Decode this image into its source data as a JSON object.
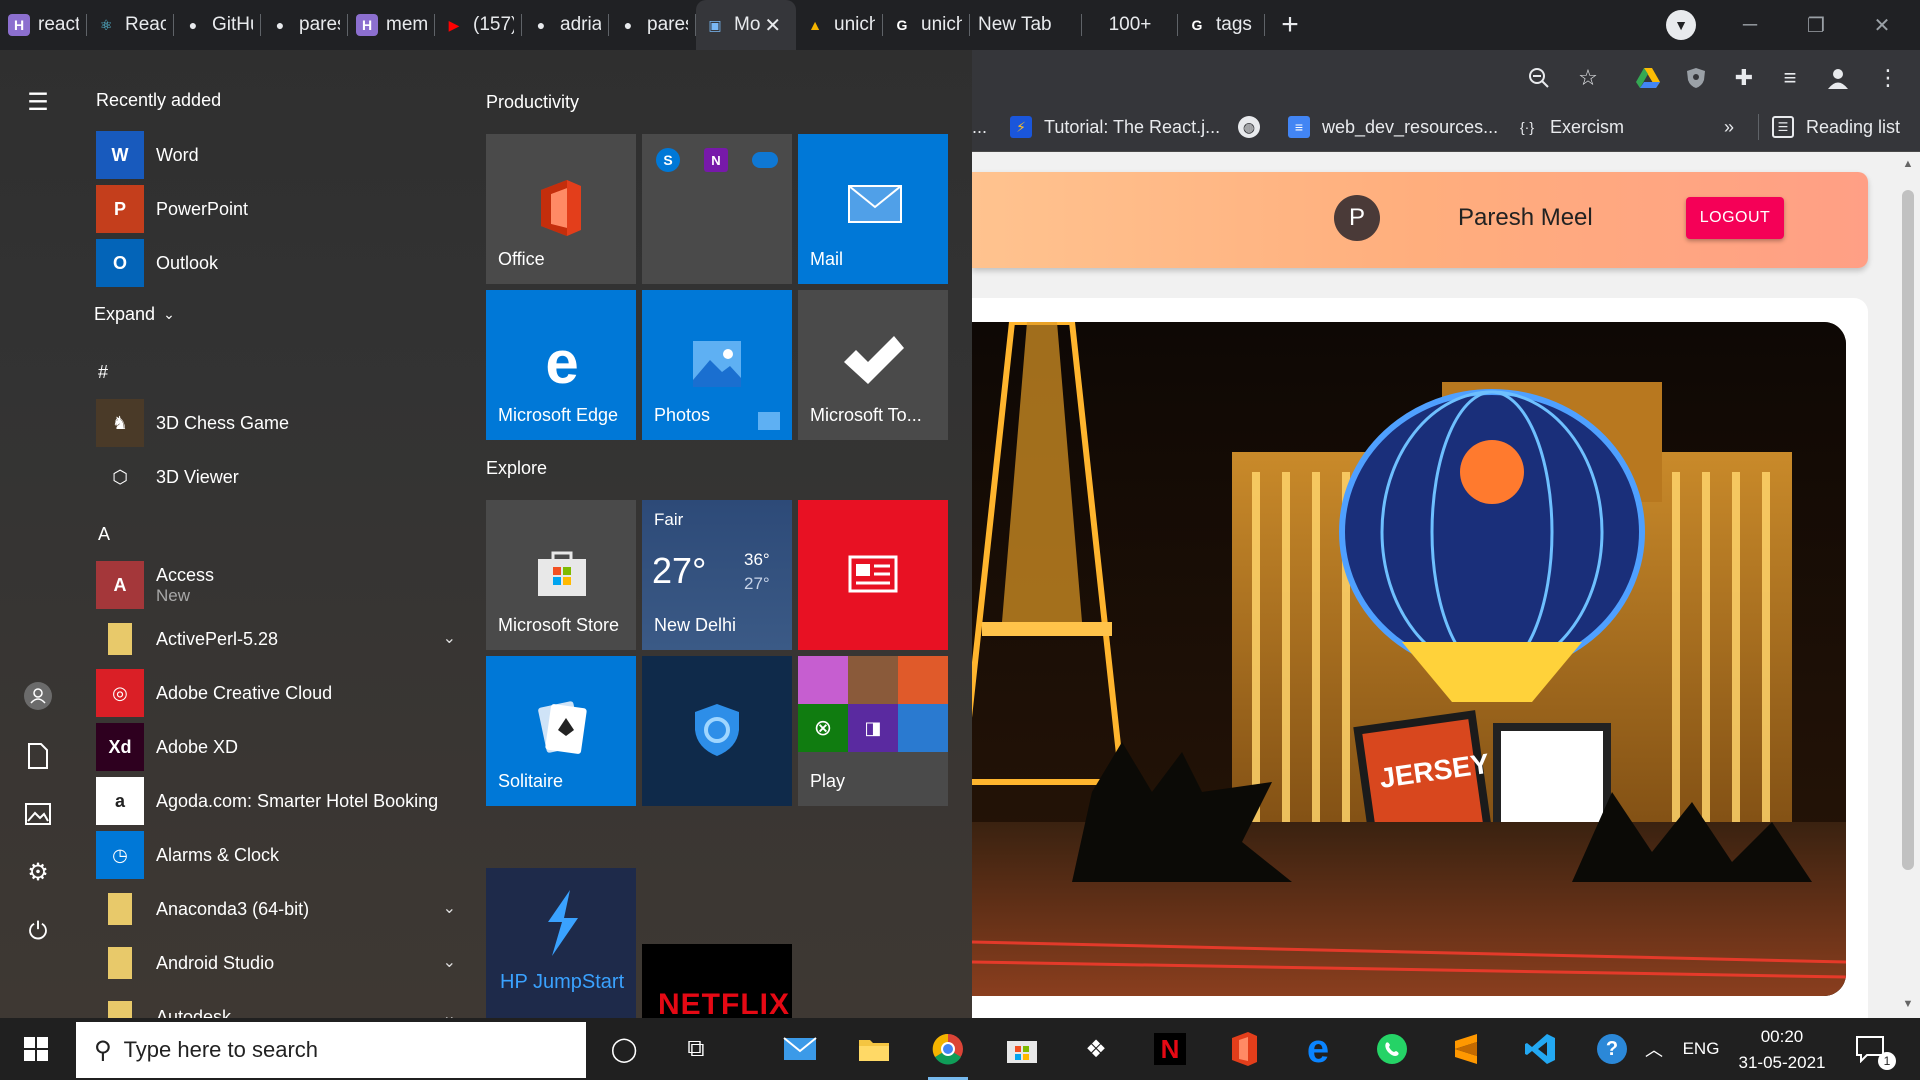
{
  "browser": {
    "tabs": [
      {
        "title": "react-",
        "icon": "h-logo-icon",
        "color": "#8c6fcf",
        "glyph": "H"
      },
      {
        "title": "React",
        "icon": "react-icon",
        "color": "#61dafb",
        "glyph": "⚛"
      },
      {
        "title": "GitHu",
        "icon": "github-icon",
        "color": "#e8eaed",
        "glyph": "●"
      },
      {
        "title": "paresl",
        "icon": "github-icon",
        "color": "#e8eaed",
        "glyph": "●"
      },
      {
        "title": "memc",
        "icon": "h-logo-icon",
        "color": "#8c6fcf",
        "glyph": "H"
      },
      {
        "title": "(157)",
        "icon": "youtube-icon",
        "color": "#ff0000",
        "glyph": "▶"
      },
      {
        "title": "adrian",
        "icon": "github-icon",
        "color": "#e8eaed",
        "glyph": "●"
      },
      {
        "title": "paresl",
        "icon": "github-icon",
        "color": "#e8eaed",
        "glyph": "●"
      },
      {
        "title": "Mo",
        "icon": "page-icon",
        "color": "#7ab8f5",
        "glyph": "▣",
        "active": true
      },
      {
        "title": "unicha",
        "icon": "fire-icon",
        "color": "#f4b400",
        "glyph": "▲"
      },
      {
        "title": "unicha",
        "icon": "google-icon",
        "color": "#ffffff",
        "glyph": "G"
      },
      {
        "title": "New Tab",
        "icon": "",
        "color": "",
        "glyph": ""
      },
      {
        "title": "100+",
        "icon": "",
        "color": "",
        "glyph": ""
      },
      {
        "title": "tags fo",
        "icon": "google-icon",
        "color": "#ffffff",
        "glyph": "G"
      }
    ],
    "bookmarks": {
      "overflow": "...",
      "items": [
        {
          "label": "Tutorial: The React.j...",
          "icon": "react-bookmark-icon"
        },
        {
          "label": "",
          "icon": "globe-icon"
        },
        {
          "label": "web_dev_resources...",
          "icon": "docs-icon"
        },
        {
          "label": "Exercism",
          "icon": "exercism-icon"
        }
      ],
      "more": "»",
      "reading_list": "Reading list"
    }
  },
  "page": {
    "avatar_letter": "P",
    "user_name": "Paresh Meel",
    "logout_label": "LOGOUT",
    "photo_sign": "JERSEY BOYS"
  },
  "start_menu": {
    "recently_added": "Recently added",
    "recent_apps": [
      {
        "name": "Word",
        "icon": "word-icon",
        "color": "#185abd",
        "glyph": "W"
      },
      {
        "name": "PowerPoint",
        "icon": "powerpoint-icon",
        "color": "#c43e1c",
        "glyph": "P"
      },
      {
        "name": "Outlook",
        "icon": "outlook-icon",
        "color": "#0364b8",
        "glyph": "O"
      }
    ],
    "expand_label": "Expand",
    "group_hash": "#",
    "hash_apps": [
      {
        "name": "3D Chess Game",
        "icon": "chess-icon",
        "color": "#4a3a28",
        "glyph": "♞"
      },
      {
        "name": "3D Viewer",
        "icon": "cube-icon",
        "color": "transparent",
        "glyph": "⬡"
      }
    ],
    "group_a": "A",
    "a_apps": [
      {
        "name": "Access",
        "sub": "New",
        "icon": "access-icon",
        "color": "#a4373a",
        "glyph": "A"
      },
      {
        "name": "ActivePerl-5.28",
        "icon": "folder-icon",
        "color": "#e8c96a",
        "glyph": "",
        "expand": "⌄"
      },
      {
        "name": "Adobe Creative Cloud",
        "icon": "creative-cloud-icon",
        "color": "#da1f26",
        "glyph": "◎"
      },
      {
        "name": "Adobe XD",
        "icon": "adobe-xd-icon",
        "color": "#2e001f",
        "glyph": "Xd"
      },
      {
        "name": "Agoda.com: Smarter Hotel Booking",
        "icon": "agoda-icon",
        "color": "#ffffff",
        "glyph": "a"
      },
      {
        "name": "Alarms & Clock",
        "icon": "clock-icon",
        "color": "#0078d7",
        "glyph": "◷"
      },
      {
        "name": "Anaconda3 (64-bit)",
        "icon": "folder-icon",
        "color": "#e8c96a",
        "glyph": "",
        "expand": "⌄"
      },
      {
        "name": "Android Studio",
        "icon": "folder-icon",
        "color": "#e8c96a",
        "glyph": "",
        "expand": "⌄"
      },
      {
        "name": "Autodesk",
        "icon": "folder-icon",
        "color": "#e8c96a",
        "glyph": "",
        "expand": "⌄"
      }
    ],
    "productivity_header": "Productivity",
    "explore_header": "Explore",
    "tiles": {
      "office": "Office",
      "mail": "Mail",
      "edge": "Microsoft Edge",
      "photos": "Photos",
      "todo": "Microsoft To...",
      "store": "Microsoft Store",
      "weather": {
        "condition": "Fair",
        "temp": "27°",
        "high": "36°",
        "low": "27°",
        "city": "New Delhi"
      },
      "solitaire": "Solitaire",
      "play": "Play",
      "hp": "HP JumpStart",
      "netflix": "NETFLIX"
    }
  },
  "taskbar": {
    "search_placeholder": "Type here to search",
    "lang": "ENG",
    "time": "00:20",
    "date": "31-05-2021",
    "notification_count": "1"
  },
  "colors": {
    "accent_tile": "#0078d7",
    "logout": "#f50057",
    "tile_gray": "#4a4a4a",
    "news_red": "#e81123"
  }
}
